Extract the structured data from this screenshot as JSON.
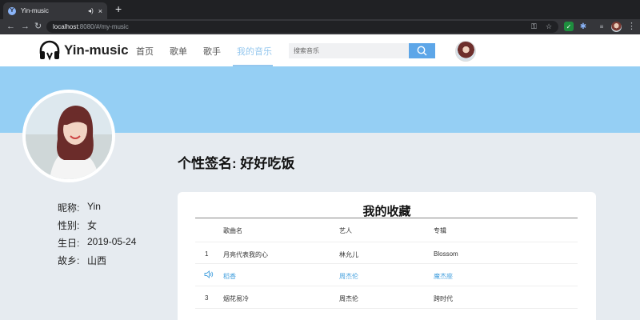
{
  "browser": {
    "tab_title": "Yin-music",
    "favicon_letter": "Y",
    "new_tab": "+",
    "close": "×",
    "sound": "◂)",
    "url_host": "localhost",
    "url_rest": ":8080/#/my-music",
    "nav": {
      "back": "←",
      "forward": "→",
      "reload": "↻"
    }
  },
  "header": {
    "logo_text": "Yin-music",
    "nav": [
      {
        "label": "首页",
        "active": false
      },
      {
        "label": "歌单",
        "active": false
      },
      {
        "label": "歌手",
        "active": false
      },
      {
        "label": "我的音乐",
        "active": true
      }
    ],
    "search_placeholder": "搜索音乐"
  },
  "profile": {
    "signature_label": "个性签名:",
    "signature_value": "好好吃饭",
    "info": [
      {
        "label": "昵称:",
        "value": "Yin"
      },
      {
        "label": "性别:",
        "value": "女"
      },
      {
        "label": "生日:",
        "value": "2019-05-24"
      },
      {
        "label": "故乡:",
        "value": "山西"
      }
    ]
  },
  "favorites": {
    "title": "我的收藏",
    "columns": {
      "song": "歌曲名",
      "artist": "艺人",
      "album": "专辑"
    },
    "rows": [
      {
        "index": "1",
        "song": "月亮代表我的心",
        "artist": "林允儿",
        "album": "Blossom",
        "playing": false
      },
      {
        "index": "",
        "song": "稻香",
        "artist": "周杰伦",
        "album": "魔杰座",
        "playing": true
      },
      {
        "index": "3",
        "song": "烟花易冷",
        "artist": "周杰伦",
        "album": "跨时代",
        "playing": false
      }
    ]
  },
  "colors": {
    "accent": "#95c7ee",
    "banner": "#95cff4",
    "search_button": "#5da6e8",
    "playing": "#4aa3df"
  }
}
